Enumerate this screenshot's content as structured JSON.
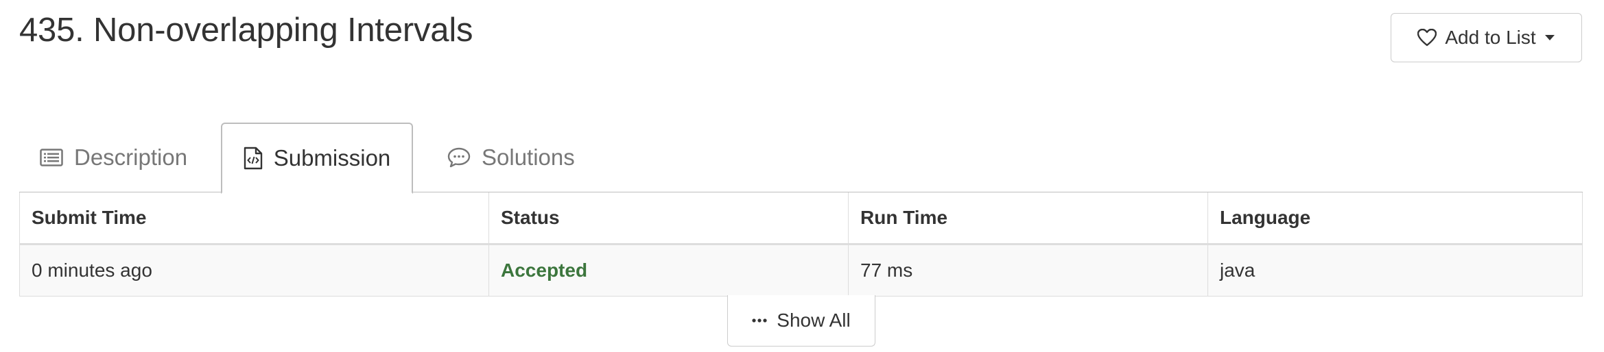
{
  "problem": {
    "title": "435. Non-overlapping Intervals"
  },
  "actions": {
    "add_to_list_label": "Add to List",
    "icons": [
      "heart-icon",
      "caret-down-icon"
    ]
  },
  "tabs": [
    {
      "label": "Description",
      "icon": "list-icon",
      "active": false
    },
    {
      "label": "Submission",
      "icon": "code-file-icon",
      "active": true
    },
    {
      "label": "Solutions",
      "icon": "comment-icon",
      "active": false
    }
  ],
  "submissions": {
    "headers": [
      "Submit Time",
      "Status",
      "Run Time",
      "Language"
    ],
    "rows": [
      {
        "submit_time": "0 minutes ago",
        "status": "Accepted",
        "run_time": "77 ms",
        "language": "java"
      }
    ],
    "show_all_label": "Show All"
  },
  "colors": {
    "accepted": "#3c763d",
    "text": "#333333",
    "muted": "#777777",
    "border": "#dddddd"
  }
}
